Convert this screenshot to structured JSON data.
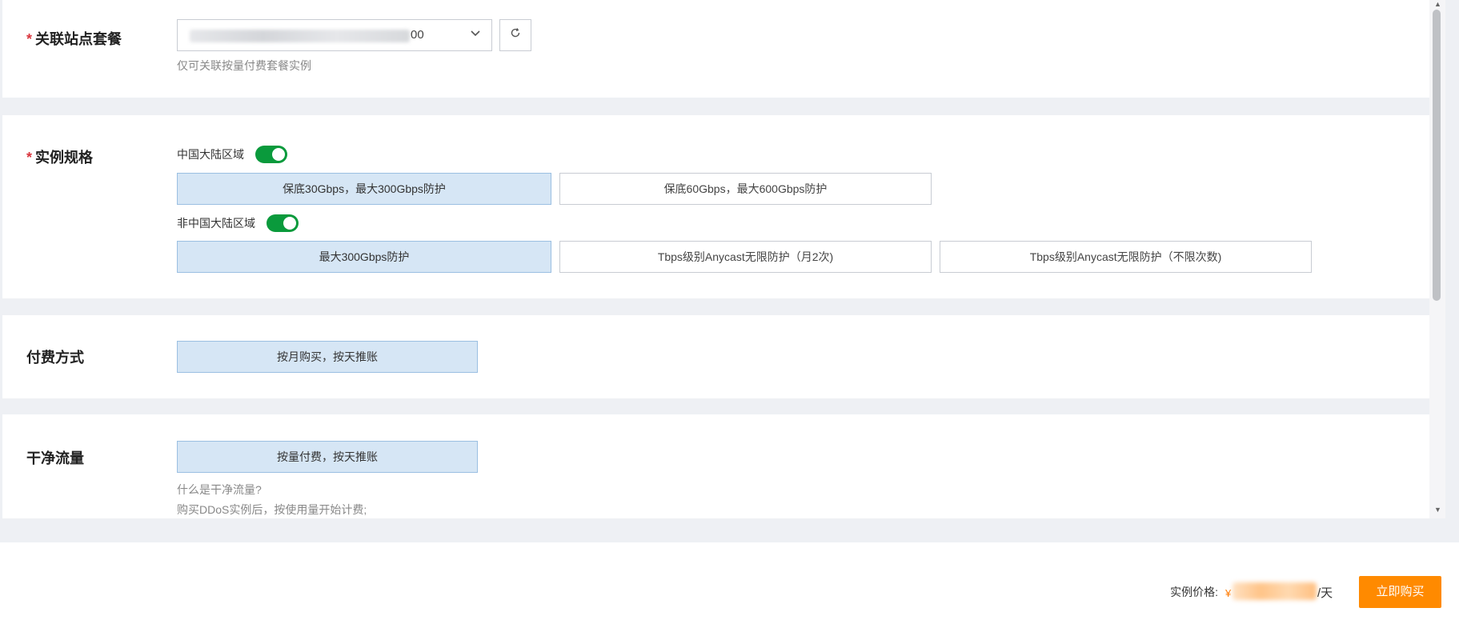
{
  "site_package": {
    "label": "关联站点套餐",
    "required_mark": "*",
    "selected_suffix": "00",
    "hint": "仅可关联按量付费套餐实例"
  },
  "instance_spec": {
    "label": "实例规格",
    "required_mark": "*",
    "mainland": {
      "label": "中国大陆区域",
      "enabled": true,
      "options": [
        {
          "label": "保底30Gbps，最大300Gbps防护",
          "selected": true
        },
        {
          "label": "保底60Gbps，最大600Gbps防护",
          "selected": false
        }
      ]
    },
    "overseas": {
      "label": "非中国大陆区域",
      "enabled": true,
      "options": [
        {
          "label": "最大300Gbps防护",
          "selected": true
        },
        {
          "label": "Tbps级别Anycast无限防护（月2次)",
          "selected": false
        },
        {
          "label": "Tbps级别Anycast无限防护（不限次数)",
          "selected": false
        }
      ]
    }
  },
  "payment": {
    "label": "付费方式",
    "option": "按月购买，按天推账"
  },
  "clean_traffic": {
    "label": "干净流量",
    "option": "按量付费，按天推账",
    "hint1": "什么是干净流量?",
    "hint2": "购买DDoS实例后，按使用量开始计费;"
  },
  "footer": {
    "price_label": "实例价格:",
    "currency": "¥",
    "unit": "/天",
    "buy_label": "立即购买"
  },
  "icons": {
    "chevron": "chevron-down-icon",
    "refresh": "refresh-icon"
  },
  "colors": {
    "accent_orange": "#ff8a00",
    "toggle_green": "#0a9a3c",
    "selected_bg": "#d6e6f5",
    "required_red": "#d9363e"
  }
}
